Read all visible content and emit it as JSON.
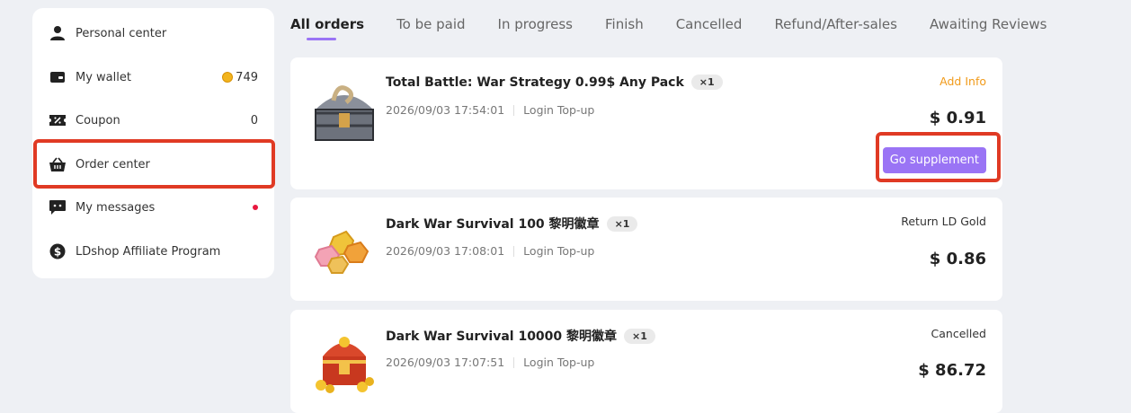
{
  "sidebar": {
    "items": [
      {
        "label": "Personal center",
        "icon": "person-icon"
      },
      {
        "label": "My wallet",
        "icon": "wallet-icon",
        "value": "749"
      },
      {
        "label": "Coupon",
        "icon": "coupon-icon",
        "value": "0"
      },
      {
        "label": "Order center",
        "icon": "basket-icon"
      },
      {
        "label": "My messages",
        "icon": "message-icon"
      },
      {
        "label": "LDshop Affiliate Program",
        "icon": "dollar-coin-icon"
      }
    ]
  },
  "tabs": [
    "All orders",
    "To be paid",
    "In progress",
    "Finish",
    "Cancelled",
    "Refund/After-sales",
    "Awaiting Reviews"
  ],
  "orders": [
    {
      "title": "Total Battle: War Strategy 0.99$ Any Pack",
      "qty": "×1",
      "date": "2026/09/03 17:54:01",
      "type": "Login Top-up",
      "status": "Add Info",
      "price": "$ 0.91",
      "action": "Go supplement"
    },
    {
      "title": "Dark War Survival 100 黎明徽章",
      "qty": "×1",
      "date": "2026/09/03 17:08:01",
      "type": "Login Top-up",
      "status": "Return LD Gold",
      "price": "$ 0.86"
    },
    {
      "title": "Dark War Survival 10000 黎明徽章",
      "qty": "×1",
      "date": "2026/09/03 17:07:51",
      "type": "Login Top-up",
      "status": "Cancelled",
      "price": "$ 86.72"
    }
  ],
  "colors": {
    "accent": "#9a74f5",
    "highlight": "#e03a24",
    "status_orange": "#f19a19",
    "dot": "#e8173f"
  }
}
